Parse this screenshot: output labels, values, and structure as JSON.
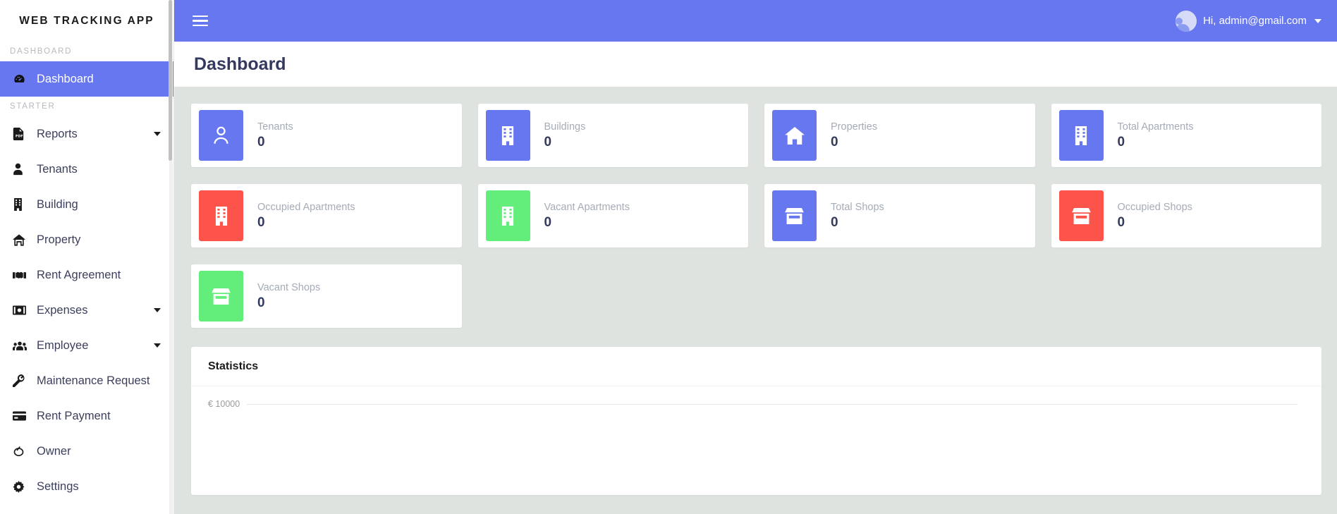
{
  "brand": {
    "title": "WEB TRACKING APP"
  },
  "sidebar": {
    "sections": [
      {
        "title": "DASHBOARD"
      },
      {
        "title": "STARTER"
      }
    ],
    "dashboard_items": [
      {
        "label": "Dashboard",
        "icon": "speedometer-icon",
        "active": true,
        "caret": false
      }
    ],
    "starter_items": [
      {
        "label": "Reports",
        "icon": "file-pdf-icon",
        "caret": true
      },
      {
        "label": "Tenants",
        "icon": "user-icon",
        "caret": false
      },
      {
        "label": "Building",
        "icon": "building-icon",
        "caret": false
      },
      {
        "label": "Property",
        "icon": "home-icon",
        "caret": false
      },
      {
        "label": "Rent Agreement",
        "icon": "handshake-icon",
        "caret": false
      },
      {
        "label": "Expenses",
        "icon": "money-bill-icon",
        "caret": true
      },
      {
        "label": "Employee",
        "icon": "users-icon",
        "caret": true
      },
      {
        "label": "Maintenance Request",
        "icon": "wrench-icon",
        "caret": false
      },
      {
        "label": "Rent Payment",
        "icon": "credit-card-icon",
        "caret": false
      },
      {
        "label": "Owner",
        "icon": "circle-slash-icon",
        "caret": false
      },
      {
        "label": "Settings",
        "icon": "gear-icon",
        "caret": false
      }
    ]
  },
  "topbar": {
    "menu_icon": "hamburger-icon",
    "user_greeting": "Hi, admin@gmail.com",
    "avatar_icon": "avatar-icon",
    "caret_icon": "chevron-down-icon"
  },
  "page": {
    "title": "Dashboard"
  },
  "cards": [
    {
      "label": "Tenants",
      "value": "0",
      "color": "#6777ef",
      "icon": "user-icon"
    },
    {
      "label": "Buildings",
      "value": "0",
      "color": "#6777ef",
      "icon": "building-icon"
    },
    {
      "label": "Properties",
      "value": "0",
      "color": "#6777ef",
      "icon": "home-icon"
    },
    {
      "label": "Total Apartments",
      "value": "0",
      "color": "#6777ef",
      "icon": "building-icon"
    },
    {
      "label": "Occupied Apartments",
      "value": "0",
      "color": "#fc544b",
      "icon": "building-icon"
    },
    {
      "label": "Vacant Apartments",
      "value": "0",
      "color": "#63ed7a",
      "icon": "building-icon"
    },
    {
      "label": "Total Shops",
      "value": "0",
      "color": "#6777ef",
      "icon": "shop-icon"
    },
    {
      "label": "Occupied Shops",
      "value": "0",
      "color": "#fc544b",
      "icon": "shop-icon"
    },
    {
      "label": "Vacant Shops",
      "value": "0",
      "color": "#63ed7a",
      "icon": "shop-icon"
    }
  ],
  "statistics": {
    "title": "Statistics"
  },
  "chart_data": {
    "type": "line",
    "title": "Statistics",
    "xlabel": "",
    "ylabel": "",
    "categories": [],
    "series": [],
    "tick_labels": [
      "€ 10000"
    ],
    "ylim": [
      0,
      10000
    ],
    "grid": true,
    "legend": "none",
    "note": "Chart area is blank except for the topmost gridline labelled € 10000"
  },
  "theme": {
    "accent": "#6777ef",
    "danger": "#fc544b",
    "success": "#63ed7a",
    "page_bg": "#dfe3e0",
    "text_dark": "#34395e",
    "text_muted": "#a5acb7"
  }
}
